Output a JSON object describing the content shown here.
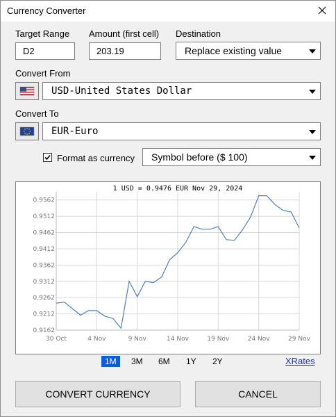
{
  "window": {
    "title": "Currency Converter"
  },
  "target": {
    "label": "Target Range",
    "value": "D2"
  },
  "amount": {
    "label": "Amount (first cell)",
    "value": "203.19"
  },
  "destination": {
    "label": "Destination",
    "value": "Replace existing value"
  },
  "convert_from": {
    "label": "Convert From",
    "value": "USD-United States Dollar"
  },
  "convert_to": {
    "label": "Convert To",
    "value": "EUR-Euro"
  },
  "format": {
    "label": "Format as currency",
    "checked": true,
    "option": "Symbol before ($ 100)"
  },
  "chart_data": {
    "type": "line",
    "title": "1 USD = 0.9476 EUR   Nov 29, 2024",
    "x_tick_labels": [
      "30 Oct",
      "4 Nov",
      "9 Nov",
      "14 Nov",
      "19 Nov",
      "24 Nov",
      "29 Nov"
    ],
    "y_tick_labels": [
      "0.9162",
      "0.9212",
      "0.9262",
      "0.9312",
      "0.9362",
      "0.9412",
      "0.9462",
      "0.9512",
      "0.9562"
    ],
    "ylim": [
      0.9162,
      0.9587
    ],
    "grid": true,
    "x": [
      0,
      1,
      2,
      3,
      4,
      5,
      6,
      7,
      8,
      9,
      10,
      11,
      12,
      13,
      14,
      15,
      16,
      17,
      18,
      19,
      20,
      21,
      22,
      23,
      24,
      25,
      26,
      27,
      28,
      29,
      30
    ],
    "values": [
      0.9245,
      0.9248,
      0.9228,
      0.9208,
      0.9222,
      0.9222,
      0.9205,
      0.9198,
      0.9168,
      0.9312,
      0.9265,
      0.9312,
      0.9308,
      0.9325,
      0.9378,
      0.94,
      0.9432,
      0.948,
      0.9472,
      0.9472,
      0.948,
      0.944,
      0.9438,
      0.947,
      0.951,
      0.9575,
      0.9575,
      0.9548,
      0.953,
      0.9525,
      0.9476
    ]
  },
  "ranges": [
    "1M",
    "3M",
    "6M",
    "1Y",
    "2Y"
  ],
  "active_range": "1M",
  "xrates_label": "XRates",
  "buttons": {
    "convert": "CONVERT CURRENCY",
    "cancel": "CANCEL"
  },
  "icons": {
    "close": "close-icon",
    "from_flag": "us-flag-icon",
    "to_flag": "eu-flag-icon",
    "dropdown": "chevron-down-icon",
    "check": "checkmark-icon"
  },
  "colors": {
    "accent": "#0a5fe0",
    "series": "#4a7fc8",
    "link": "#1c33c9",
    "grid": "#d8d8d8"
  }
}
